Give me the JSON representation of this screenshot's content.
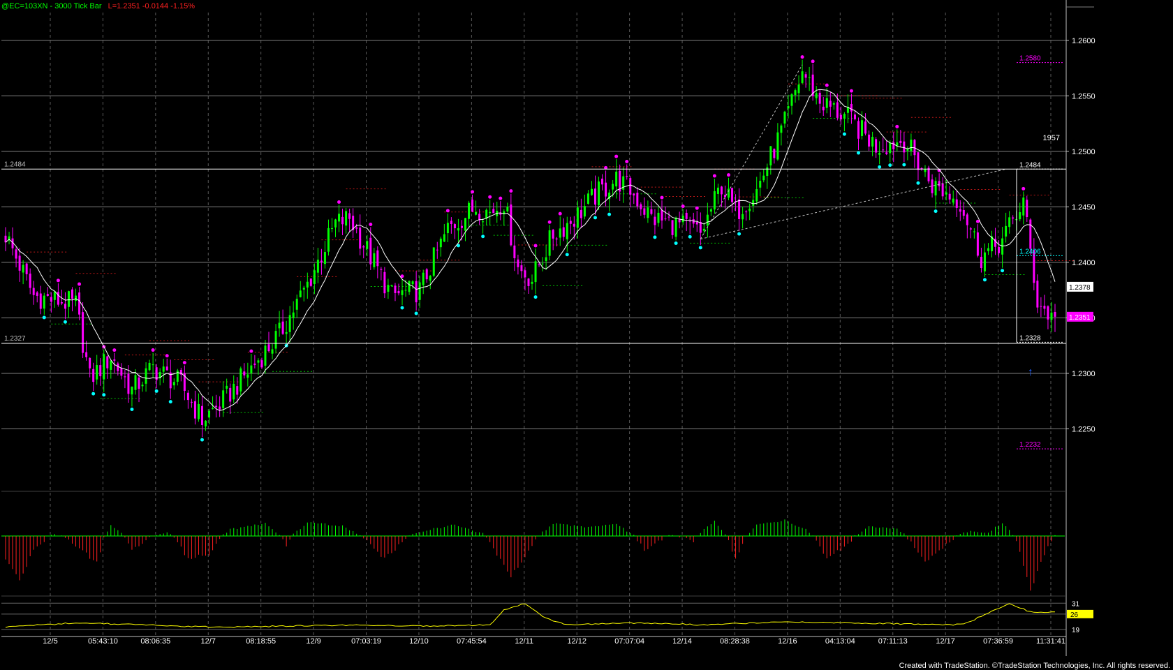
{
  "header": {
    "symbol_title": "@EC=103XN - 3000 Tick Bar",
    "last_change": "L=1.2351  -0.0144  -1.15%"
  },
  "footer": {
    "credit": "Created with TradeStation. ©TradeStation Technologies, Inc. All rights reserved."
  },
  "colors": {
    "background": "#000000",
    "up_bar": "#00ff00",
    "down_bar": "#ff00ff",
    "swing_high_dot": "#ff00ff",
    "swing_low_dot": "#00ffff",
    "moving_average": "#ffffff",
    "osc_positive": "#00ff00",
    "osc_negative": "#ff2020",
    "lower_line": "#ffff00",
    "grid": "#a0a0a0"
  },
  "chart_data": [
    {
      "type": "candlestick",
      "pane": "price",
      "title": "@EC=103XN - 3000 Tick Bar",
      "ylim": [
        1.2195,
        1.2625
      ],
      "y_ticks": [
        "1.2600",
        "1.2550",
        "1.2500",
        "1.2450",
        "1.2400",
        "1.2350",
        "1.2300",
        "1.2250"
      ],
      "x_tick_labels": [
        "12/5",
        "05:43:10",
        "08:06:35",
        "12/7",
        "08:18:55",
        "12/9",
        "07:03:19",
        "12/10",
        "07:45:54",
        "12/11",
        "12/12",
        "07:07:04",
        "12/14",
        "08:28:38",
        "12/16",
        "04:13:04",
        "07:11:13",
        "12/17",
        "07:36:59",
        "11:31:41"
      ],
      "num_bars": 300,
      "close_path_keypoints": [
        [
          0,
          1.2425
        ],
        [
          8,
          1.237
        ],
        [
          20,
          1.2362
        ],
        [
          24,
          1.2295
        ],
        [
          30,
          1.2315
        ],
        [
          36,
          1.2285
        ],
        [
          42,
          1.2305
        ],
        [
          50,
          1.229
        ],
        [
          56,
          1.2258
        ],
        [
          62,
          1.2275
        ],
        [
          70,
          1.2305
        ],
        [
          78,
          1.2335
        ],
        [
          86,
          1.238
        ],
        [
          94,
          1.2435
        ],
        [
          98,
          1.244
        ],
        [
          104,
          1.2405
        ],
        [
          110,
          1.237
        ],
        [
          118,
          1.2375
        ],
        [
          126,
          1.243
        ],
        [
          134,
          1.245
        ],
        [
          138,
          1.2445
        ],
        [
          142,
          1.2455
        ],
        [
          146,
          1.2395
        ],
        [
          150,
          1.2385
        ],
        [
          156,
          1.2425
        ],
        [
          162,
          1.244
        ],
        [
          168,
          1.246
        ],
        [
          174,
          1.2475
        ],
        [
          178,
          1.2465
        ],
        [
          184,
          1.244
        ],
        [
          190,
          1.2435
        ],
        [
          196,
          1.243
        ],
        [
          198,
          1.2425
        ],
        [
          204,
          1.247
        ],
        [
          208,
          1.2445
        ],
        [
          214,
          1.2465
        ],
        [
          222,
          1.2525
        ],
        [
          227,
          1.2572
        ],
        [
          232,
          1.2545
        ],
        [
          240,
          1.253
        ],
        [
          248,
          1.2505
        ],
        [
          256,
          1.251
        ],
        [
          264,
          1.247
        ],
        [
          272,
          1.2455
        ],
        [
          278,
          1.2405
        ],
        [
          284,
          1.242
        ],
        [
          290,
          1.2455
        ],
        [
          294,
          1.2365
        ],
        [
          298,
          1.235
        ]
      ],
      "last": 1.2351,
      "swing_high_labels": [
        {
          "value": 1.2484,
          "label": "1957"
        },
        {
          "value": 1.258
        }
      ],
      "levels": [
        {
          "label": "1.2484",
          "value": 1.2484,
          "side": "left"
        },
        {
          "label": "1.2327",
          "value": 1.2327,
          "side": "left"
        },
        {
          "label": "1.2484",
          "value": 1.2484,
          "side": "right",
          "style": "dotted"
        },
        {
          "label": "1.2328",
          "value": 1.2328,
          "side": "right",
          "style": "dotted"
        },
        {
          "label": "1.2580",
          "value": 1.258,
          "side": "right",
          "color": "magenta"
        },
        {
          "label": "1.2232",
          "value": 1.2232,
          "side": "right",
          "color": "magenta"
        },
        {
          "label": "1.2406",
          "value": 1.2406,
          "side": "right",
          "color": "cyan"
        }
      ],
      "price_boxes": [
        {
          "label": "1.2378",
          "value": 1.2378,
          "bg": "#ffffff",
          "fg": "#000000"
        },
        {
          "label": "1.2351",
          "value": 1.2351,
          "bg": "#ff00ff",
          "fg": "#ffffff"
        }
      ],
      "annotations": [
        {
          "text": "1957"
        }
      ]
    },
    {
      "type": "histogram",
      "pane": "oscillator",
      "zero_line": true,
      "bar_colors": {
        "positive": "#00ff00",
        "negative": "#ff2020"
      },
      "values_keypoints": [
        [
          0,
          -0.5
        ],
        [
          4,
          -1.0
        ],
        [
          8,
          -0.3
        ],
        [
          14,
          0.1
        ],
        [
          20,
          -0.2
        ],
        [
          26,
          -0.6
        ],
        [
          30,
          0.5
        ],
        [
          36,
          -0.3
        ],
        [
          46,
          0.2
        ],
        [
          52,
          -0.5
        ],
        [
          58,
          -0.4
        ],
        [
          64,
          0.3
        ],
        [
          74,
          0.55
        ],
        [
          80,
          -0.2
        ],
        [
          86,
          0.6
        ],
        [
          96,
          0.45
        ],
        [
          100,
          0.1
        ],
        [
          108,
          -0.5
        ],
        [
          118,
          0.2
        ],
        [
          128,
          0.5
        ],
        [
          136,
          0.1
        ],
        [
          144,
          -0.9
        ],
        [
          150,
          -0.2
        ],
        [
          156,
          0.55
        ],
        [
          166,
          0.4
        ],
        [
          174,
          0.55
        ],
        [
          182,
          -0.3
        ],
        [
          190,
          0.05
        ],
        [
          196,
          -0.1
        ],
        [
          202,
          0.65
        ],
        [
          208,
          -0.5
        ],
        [
          214,
          0.5
        ],
        [
          222,
          0.7
        ],
        [
          228,
          0.3
        ],
        [
          234,
          -0.5
        ],
        [
          240,
          -0.2
        ],
        [
          246,
          0.4
        ],
        [
          254,
          0.3
        ],
        [
          262,
          -0.6
        ],
        [
          268,
          -0.2
        ],
        [
          274,
          0.2
        ],
        [
          280,
          0.15
        ],
        [
          284,
          0.6
        ],
        [
          288,
          -0.1
        ],
        [
          292,
          -1.2
        ],
        [
          296,
          -0.4
        ],
        [
          299,
          0.05
        ]
      ]
    },
    {
      "type": "line",
      "pane": "lower",
      "series": [
        {
          "color": "#ffff00"
        }
      ],
      "y_ticks": [
        "31",
        "26",
        "19"
      ],
      "current_value_box": {
        "label": "26",
        "bg": "#ffff00",
        "fg": "#000000"
      },
      "values_keypoints": [
        [
          0,
          20
        ],
        [
          20,
          22
        ],
        [
          40,
          21
        ],
        [
          60,
          20
        ],
        [
          80,
          20.5
        ],
        [
          100,
          21
        ],
        [
          120,
          20.5
        ],
        [
          138,
          21
        ],
        [
          142,
          28
        ],
        [
          148,
          31
        ],
        [
          154,
          24
        ],
        [
          160,
          21
        ],
        [
          180,
          22
        ],
        [
          200,
          21
        ],
        [
          220,
          22.5
        ],
        [
          240,
          22
        ],
        [
          270,
          21
        ],
        [
          274,
          22
        ],
        [
          282,
          28
        ],
        [
          286,
          31
        ],
        [
          292,
          27
        ],
        [
          299,
          27
        ]
      ]
    }
  ]
}
